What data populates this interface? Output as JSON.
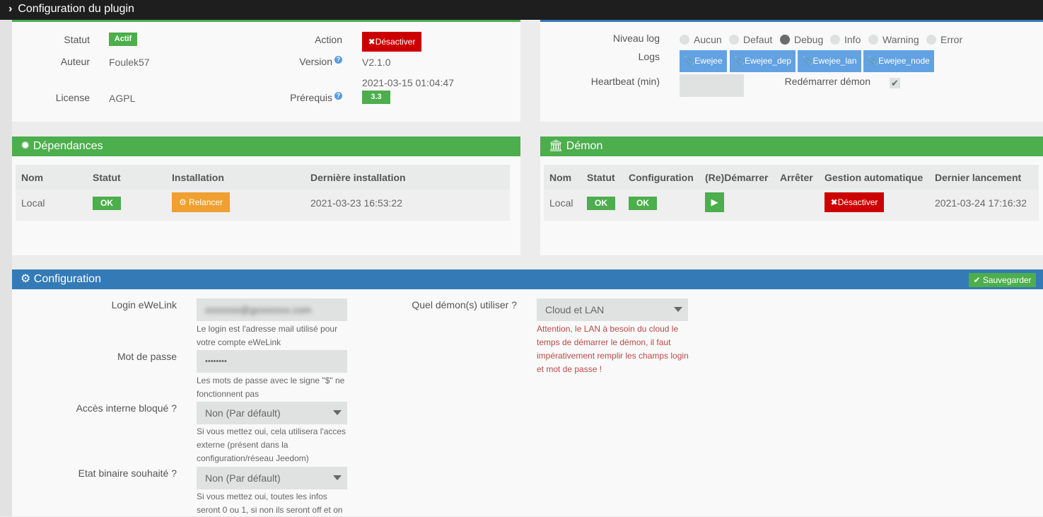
{
  "topbar": {
    "title": "Configuration du plugin"
  },
  "info": {
    "statut_label": "Statut",
    "statut_value": "Actif",
    "auteur_label": "Auteur",
    "auteur_value": "Foulek57",
    "license_label": "License",
    "license_value": "AGPL",
    "action_label": "Action",
    "action_button": "Désactiver",
    "version_label": "Version",
    "version_value": "V2.1.0",
    "version_date": "2021-03-15 01:04:47",
    "prerequis_label": "Prérequis",
    "prerequis_value": "3.3"
  },
  "logs": {
    "niveau_label": "Niveau log",
    "levels": [
      "Aucun",
      "Defaut",
      "Debug",
      "Info",
      "Warning",
      "Error"
    ],
    "selected": "Debug",
    "logs_label": "Logs",
    "log_buttons": [
      "Ewejee",
      "Ewejee_dep",
      "Ewejee_lan",
      "Ewejee_node"
    ],
    "heartbeat_label": "Heartbeat (min)",
    "heartbeat_value": "",
    "restart_label": "Redémarrer démon",
    "restart_checked": true
  },
  "dependances": {
    "title": "Dépendances",
    "headers": [
      "Nom",
      "Statut",
      "Installation",
      "Dernière installation"
    ],
    "row": {
      "nom": "Local",
      "statut": "OK",
      "installation": "Relancer",
      "date": "2021-03-23 16:53:22"
    }
  },
  "demon": {
    "title": "Démon",
    "headers": [
      "Nom",
      "Statut",
      "Configuration",
      "(Re)Démarrer",
      "Arrêter",
      "Gestion automatique",
      "Dernier lancement"
    ],
    "row": {
      "nom": "Local",
      "statut": "OK",
      "configuration": "OK",
      "gestion": "Désactiver",
      "date": "2021-03-24 17:16:32"
    }
  },
  "config": {
    "title": "Configuration",
    "save": "Sauvegarder",
    "login_label": "Login eWeLink",
    "login_value": "xxxxxxx@gxxxxxxx.com",
    "login_hint": "Le login est l'adresse mail utilisé pour votre compte eWeLink",
    "password_label": "Mot de passe",
    "password_value": "••••••••",
    "password_hint": "Les mots de passe avec le signe \"$\" ne fonctionnent pas",
    "acces_label": "Accès interne bloqué ?",
    "acces_value": "Non (Par défault)",
    "acces_hint": "Si vous mettez oui, cela utilisera l'acces externe (présent dans la configuration/réseau Jeedom)",
    "etat_label": "Etat binaire souhaité ?",
    "etat_value": "Non (Par défault)",
    "etat_hint": "Si vous mettez oui, toutes les infos seront 0 ou 1, si non ils seront off et on",
    "demon_label": "Quel démon(s) utiliser ?",
    "demon_value": "Cloud et LAN",
    "demon_warning": "Attention, le LAN à besoin du cloud le temps de démarrer le démon, il faut impérativement remplir les champs login et mot de passe !"
  },
  "colors": {
    "green": "#4cae4c",
    "blue": "#337ab7",
    "red": "#cc0000",
    "orange": "#f0a030",
    "logblue": "#62a2e3"
  }
}
